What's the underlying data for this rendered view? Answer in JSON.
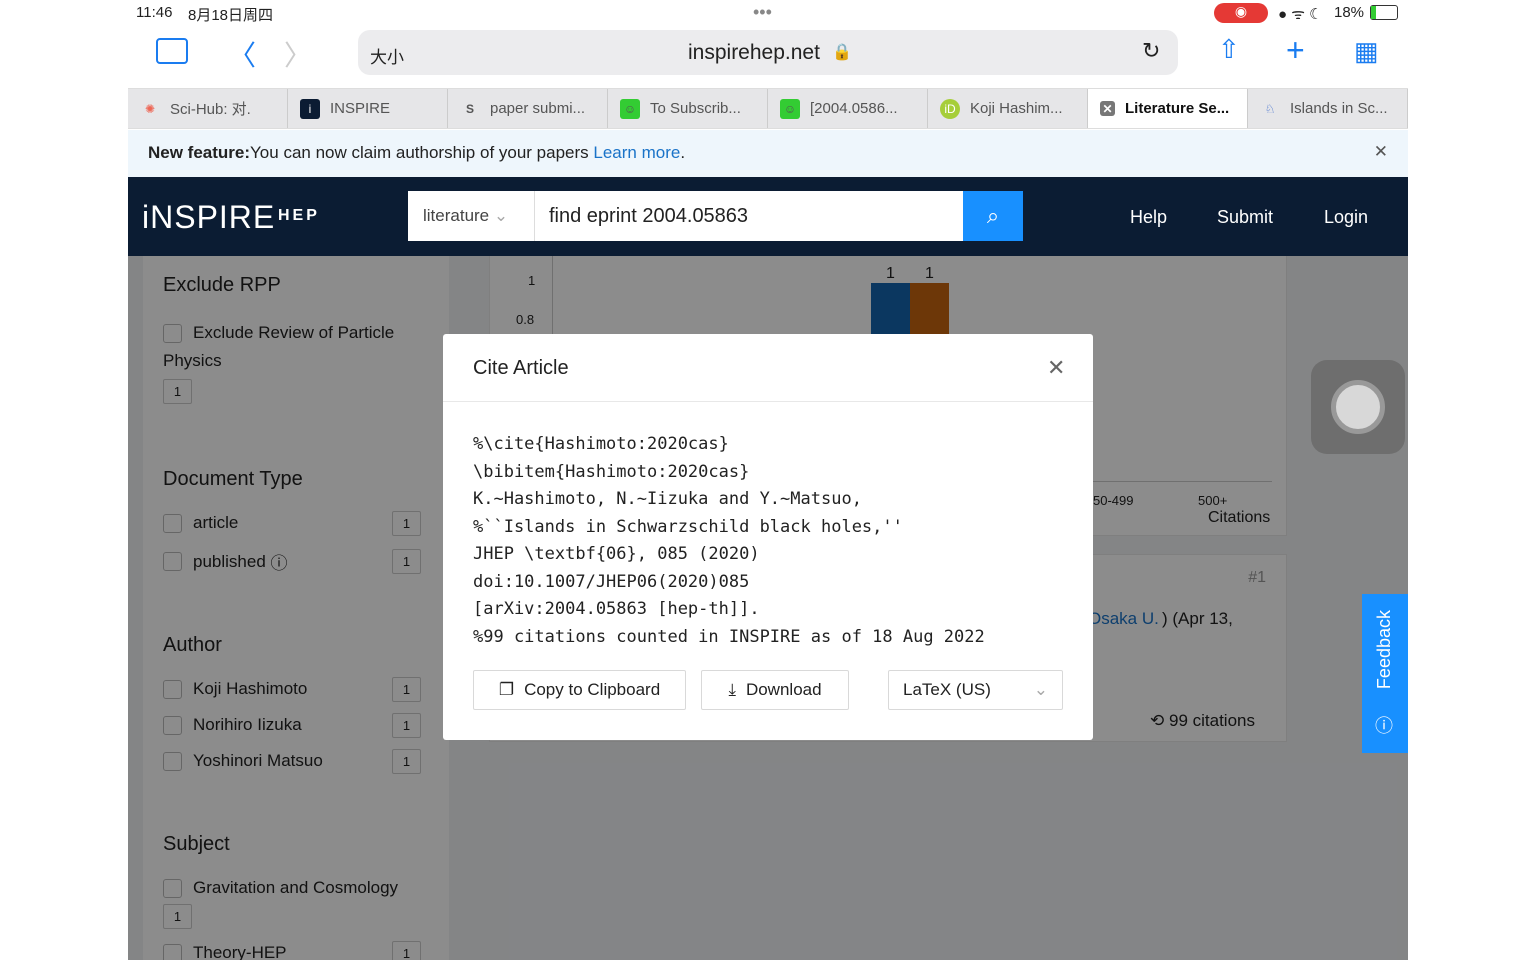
{
  "status": {
    "time": "11:46",
    "date": "8月18日周四",
    "battery": "18%"
  },
  "browser": {
    "text_size": "大小",
    "url": "inspirehep.net"
  },
  "tabs": [
    {
      "label": "Sci-Hub: 对.",
      "icon": "scihub-icon"
    },
    {
      "label": "INSPIRE",
      "icon": "inspire-icon"
    },
    {
      "label": "paper submi...",
      "icon": "s-icon"
    },
    {
      "label": "To Subscrib...",
      "icon": "smiley-icon"
    },
    {
      "label": "[2004.0586...",
      "icon": "smiley-icon"
    },
    {
      "label": "Koji Hashim...",
      "icon": "orcid-icon"
    },
    {
      "label": "Literature Se...",
      "icon": "close-icon",
      "active": true
    },
    {
      "label": "Islands in Sc...",
      "icon": "scholar-icon"
    }
  ],
  "banner": {
    "bold": "New feature:",
    "text": "You can now claim authorship of your papers ",
    "link": "Learn more",
    "end": "."
  },
  "header": {
    "logo": "iNSPIRE",
    "logo_sub": "HEP",
    "search_scope": "literature",
    "search_value": "find eprint 2004.05863",
    "nav": [
      "Help",
      "Submit",
      "Login"
    ]
  },
  "sidebar": {
    "exclude_rpp": {
      "title": "Exclude RPP",
      "label": "Exclude Review of Particle Physics",
      "count": "1"
    },
    "doc_type": {
      "title": "Document Type",
      "items": [
        {
          "label": "article",
          "count": "1"
        },
        {
          "label": "published",
          "count": "1"
        }
      ]
    },
    "author": {
      "title": "Author",
      "items": [
        {
          "label": "Koji Hashimoto",
          "count": "1"
        },
        {
          "label": "Norihiro Iizuka",
          "count": "1"
        },
        {
          "label": "Yoshinori Matsuo",
          "count": "1"
        }
      ]
    },
    "subject": {
      "title": "Subject",
      "items": [
        {
          "label": "Gravitation and Cosmology",
          "count": "1"
        },
        {
          "label": "Theory-HEP",
          "count": "1"
        }
      ]
    }
  },
  "chart": {
    "y_ticks": [
      "1",
      "0.8"
    ],
    "bar_labels": [
      "1",
      "1"
    ],
    "x_ticks": [
      "50-499",
      "500+"
    ],
    "x_label": "Citations",
    "colors": [
      "#1565b0",
      "#c6640f"
    ]
  },
  "result": {
    "rank": "#1",
    "affil": "Osaka U.",
    "date": ") (Apr 13,",
    "citations": "99 citations"
  },
  "feedback": "Feedback",
  "modal": {
    "title": "Cite Article",
    "citation": "%\\cite{Hashimoto:2020cas}\n\\bibitem{Hashimoto:2020cas}\nK.~Hashimoto, N.~Iizuka and Y.~Matsuo,\n%``Islands in Schwarzschild black holes,''\nJHEP \\textbf{06}, 085 (2020)\ndoi:10.1007/JHEP06(2020)085\n[arXiv:2004.05863 [hep-th]].\n%99 citations counted in INSPIRE as of 18 Aug 2022",
    "copy": "Copy to Clipboard",
    "download": "Download",
    "format": "LaTeX (US)"
  }
}
